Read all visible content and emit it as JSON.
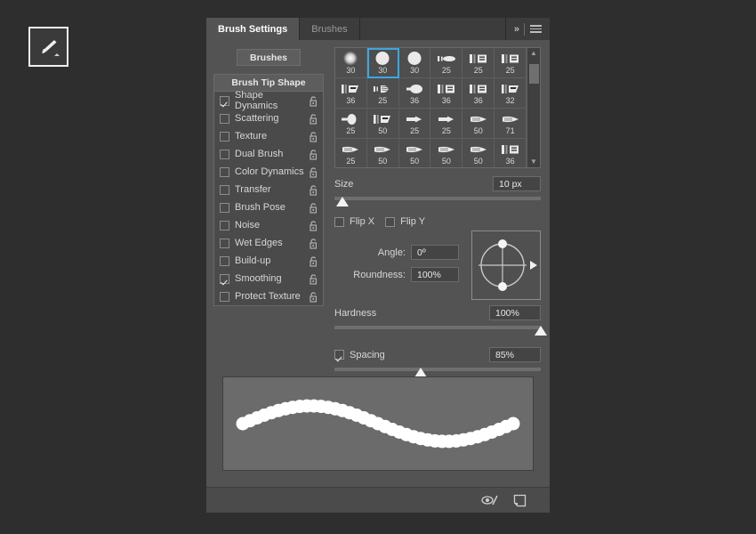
{
  "toolbar": {
    "tool_button_name": "brush-tool",
    "tool_icon": "paintbrush-icon"
  },
  "panel": {
    "tabs": [
      {
        "label": "Brush Settings",
        "active": true
      },
      {
        "label": "Brushes",
        "active": false
      }
    ],
    "collapse_label": "»",
    "menu_icon": "hamburger-menu-icon",
    "brushes_button_label": "Brushes",
    "list_header": "Brush Tip Shape",
    "options": [
      {
        "label": "Shape Dynamics",
        "checked": true
      },
      {
        "label": "Scattering",
        "checked": false
      },
      {
        "label": "Texture",
        "checked": false
      },
      {
        "label": "Dual Brush",
        "checked": false
      },
      {
        "label": "Color Dynamics",
        "checked": false
      },
      {
        "label": "Transfer",
        "checked": false
      },
      {
        "label": "Brush Pose",
        "checked": false
      },
      {
        "label": "Noise",
        "checked": false
      },
      {
        "label": "Wet Edges",
        "checked": false
      },
      {
        "label": "Build-up",
        "checked": false
      },
      {
        "label": "Smoothing",
        "checked": true
      },
      {
        "label": "Protect Texture",
        "checked": false
      }
    ],
    "brush_grid": {
      "selected_index": 1,
      "cells": [
        {
          "size": "30",
          "shape": "soft-round"
        },
        {
          "size": "30",
          "shape": "hard-round"
        },
        {
          "size": "30",
          "shape": "hard-round"
        },
        {
          "size": "25",
          "shape": "flat-tip"
        },
        {
          "size": "25",
          "shape": "flat-block"
        },
        {
          "size": "25",
          "shape": "flat-block"
        },
        {
          "size": "36",
          "shape": "angled-flat"
        },
        {
          "size": "25",
          "shape": "bristle"
        },
        {
          "size": "36",
          "shape": "round-point"
        },
        {
          "size": "36",
          "shape": "flat-block"
        },
        {
          "size": "36",
          "shape": "flat-block"
        },
        {
          "size": "32",
          "shape": "angled-flat"
        },
        {
          "size": "25",
          "shape": "fan"
        },
        {
          "size": "50",
          "shape": "angled-flat"
        },
        {
          "size": "25",
          "shape": "flat-arrow"
        },
        {
          "size": "25",
          "shape": "flat-arrow"
        },
        {
          "size": "50",
          "shape": "pencil"
        },
        {
          "size": "71",
          "shape": "pencil"
        },
        {
          "size": "25",
          "shape": "pencil"
        },
        {
          "size": "50",
          "shape": "pencil"
        },
        {
          "size": "50",
          "shape": "pencil"
        },
        {
          "size": "50",
          "shape": "pencil"
        },
        {
          "size": "50",
          "shape": "pencil"
        },
        {
          "size": "36",
          "shape": "flat-block"
        }
      ]
    },
    "settings": {
      "size_label": "Size",
      "size_value": "10 px",
      "size_slider_pct": 4,
      "flip_x_label": "Flip X",
      "flip_x_checked": false,
      "flip_y_label": "Flip Y",
      "flip_y_checked": false,
      "angle_label": "Angle:",
      "angle_value": "0º",
      "roundness_label": "Roundness:",
      "roundness_value": "100%",
      "hardness_label": "Hardness",
      "hardness_value": "100%",
      "hardness_slider_pct": 100,
      "spacing_label": "Spacing",
      "spacing_checked": true,
      "spacing_value": "85%",
      "spacing_slider_pct": 42
    },
    "footer": {
      "toggle_icon": "brush-preview-toggle-icon",
      "new_brush_icon": "new-brush-icon"
    },
    "colors": {
      "panel_bg": "#535353",
      "app_bg": "#2e2e2e",
      "tabbar_bg": "#3c3c3c",
      "selection_blue": "#3ea6e0",
      "text": "#d7d7d7",
      "preview_bg": "#6b6b6b"
    }
  }
}
